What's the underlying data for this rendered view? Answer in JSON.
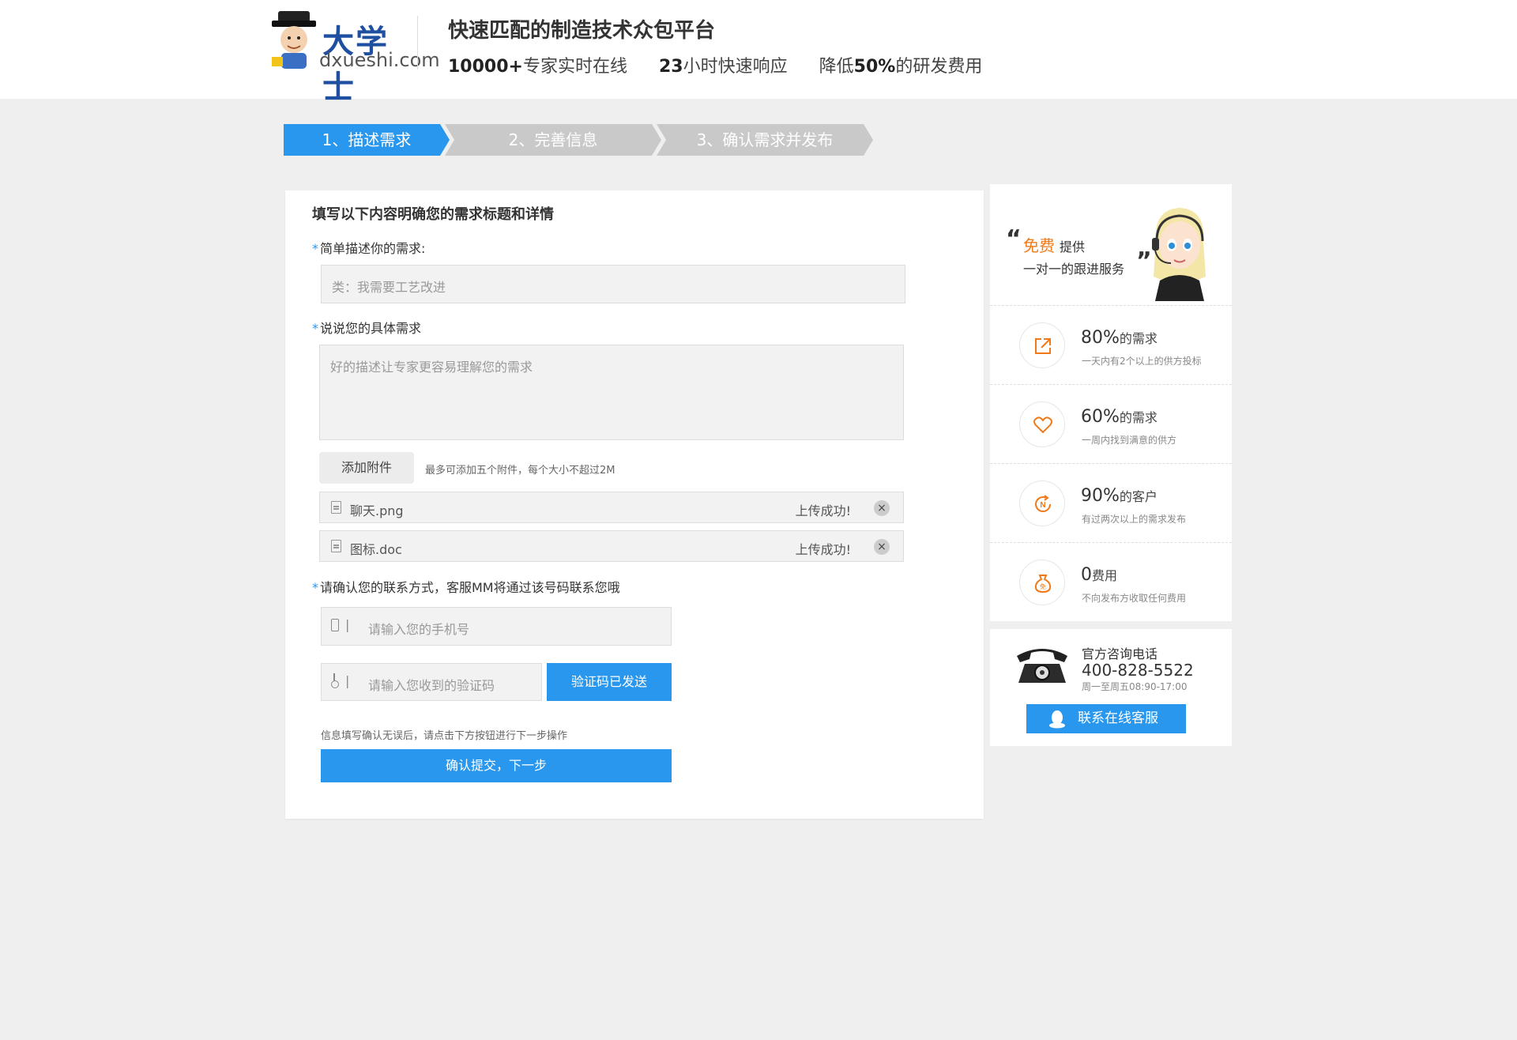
{
  "header": {
    "logo_text": "大学士",
    "logo_sub": "dxueshi.com",
    "slogan": "快速匹配的制造技术众包平台",
    "features": [
      {
        "bold": "10000+",
        "text": "专家实时在线"
      },
      {
        "bold": "23",
        "text": "小时快速响应"
      },
      {
        "prefix": "降低",
        "bold": "50%",
        "text": "的研发费用"
      }
    ]
  },
  "steps": [
    {
      "label": "1、描述需求",
      "state": "active"
    },
    {
      "label": "2、完善信息",
      "state": "inactive"
    },
    {
      "label": "3、确认需求并发布",
      "state": "inactive"
    }
  ],
  "form": {
    "title": "填写以下内容明确您的需求标题和详情",
    "req_mark": "*",
    "brief_label": "简单描述你的需求:",
    "brief_placeholder": "类：我需要工艺改进",
    "detail_label": "说说您的具体需求",
    "detail_placeholder": "好的描述让专家更容易理解您的需求",
    "attach_button": "添加附件",
    "attach_tip": "最多可添加五个附件，每个大小不超过2M",
    "files": [
      {
        "name": "聊天.png",
        "status": "上传成功!"
      },
      {
        "name": "图标.doc",
        "status": "上传成功!"
      }
    ],
    "contact_label": "请确认您的联系方式，客服MM将通过该号码联系您哦",
    "phone_placeholder": "请输入您的手机号",
    "code_placeholder": "请输入您收到的验证码",
    "code_button": "验证码已发送",
    "confirm_tip": "信息填写确认无误后，请点击下方按钮进行下一步操作",
    "submit_button": "确认提交，下一步"
  },
  "side": {
    "free": "免费",
    "provide": "提供",
    "service": "一对一的跟进服务",
    "stats": [
      {
        "num": "80%",
        "unit": "的需求",
        "desc": "一天内有2个以上的供方投标",
        "icon": "external-link-icon"
      },
      {
        "num": "60%",
        "unit": "的需求",
        "desc": "一周内找到满意的供方",
        "icon": "heart-icon"
      },
      {
        "num": "90%",
        "unit": "的客户",
        "desc": "有过两次以上的需求发布",
        "icon": "refresh-n-icon"
      },
      {
        "num": "0",
        "unit": "费用",
        "desc": "不向发布方收取任何费用",
        "icon": "money-bag-icon"
      }
    ],
    "accent": "#f07a19"
  },
  "contact": {
    "title": "官方咨询电话",
    "number": "400-828-5522",
    "hours": "周一至周五08:90-17:00",
    "qq_button": "联系在线客服"
  },
  "colors": {
    "primary": "#2a97ee",
    "inactive_step": "#c9c9c9",
    "background": "#efefef"
  }
}
